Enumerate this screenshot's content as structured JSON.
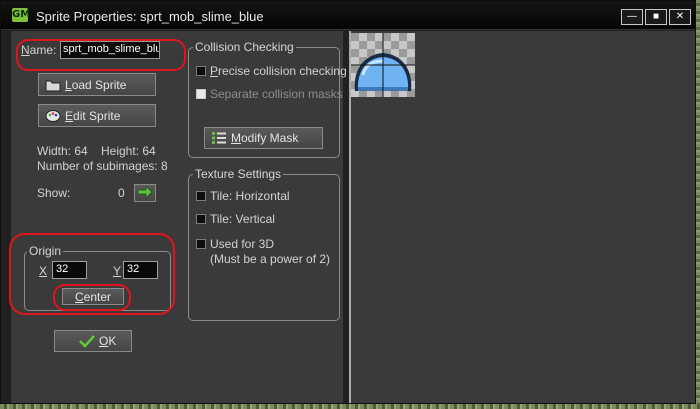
{
  "window": {
    "title": "Sprite Properties: sprt_mob_slime_blue",
    "app_icon_glyph": "GM",
    "controls": {
      "minimize": "—",
      "maximize": "■",
      "close": "✕"
    }
  },
  "name": {
    "label": "Name:",
    "value": "sprt_mob_slime_blu"
  },
  "buttons": {
    "load_sprite": "Load Sprite",
    "edit_sprite": "Edit Sprite",
    "modify_mask": "Modify Mask",
    "center": "Center",
    "ok": "OK"
  },
  "info": {
    "width": "Width: 64",
    "height": "Height: 64",
    "subimages": "Number of subimages: 8"
  },
  "show": {
    "label": "Show:",
    "value": "0",
    "next_icon": "arrow-right-icon"
  },
  "origin": {
    "legend": "Origin",
    "x_label": "X",
    "x_value": "32",
    "y_label": "Y",
    "y_value": "32"
  },
  "collision": {
    "legend": "Collision Checking",
    "precise": "Precise collision checking",
    "separate": "Separate collision masks"
  },
  "texture": {
    "legend": "Texture Settings",
    "tile_h": "Tile: Horizontal",
    "tile_v": "Tile: Vertical",
    "used_3d_line1": "Used for 3D",
    "used_3d_line2": "(Must be a power of 2)"
  },
  "colors": {
    "panel": "#3a3a3a",
    "titlebar": "#0a0a0a",
    "annotation_red": "#e0151c",
    "accent_green": "#7ec13d",
    "slime_blue": "#6fb3f2"
  }
}
